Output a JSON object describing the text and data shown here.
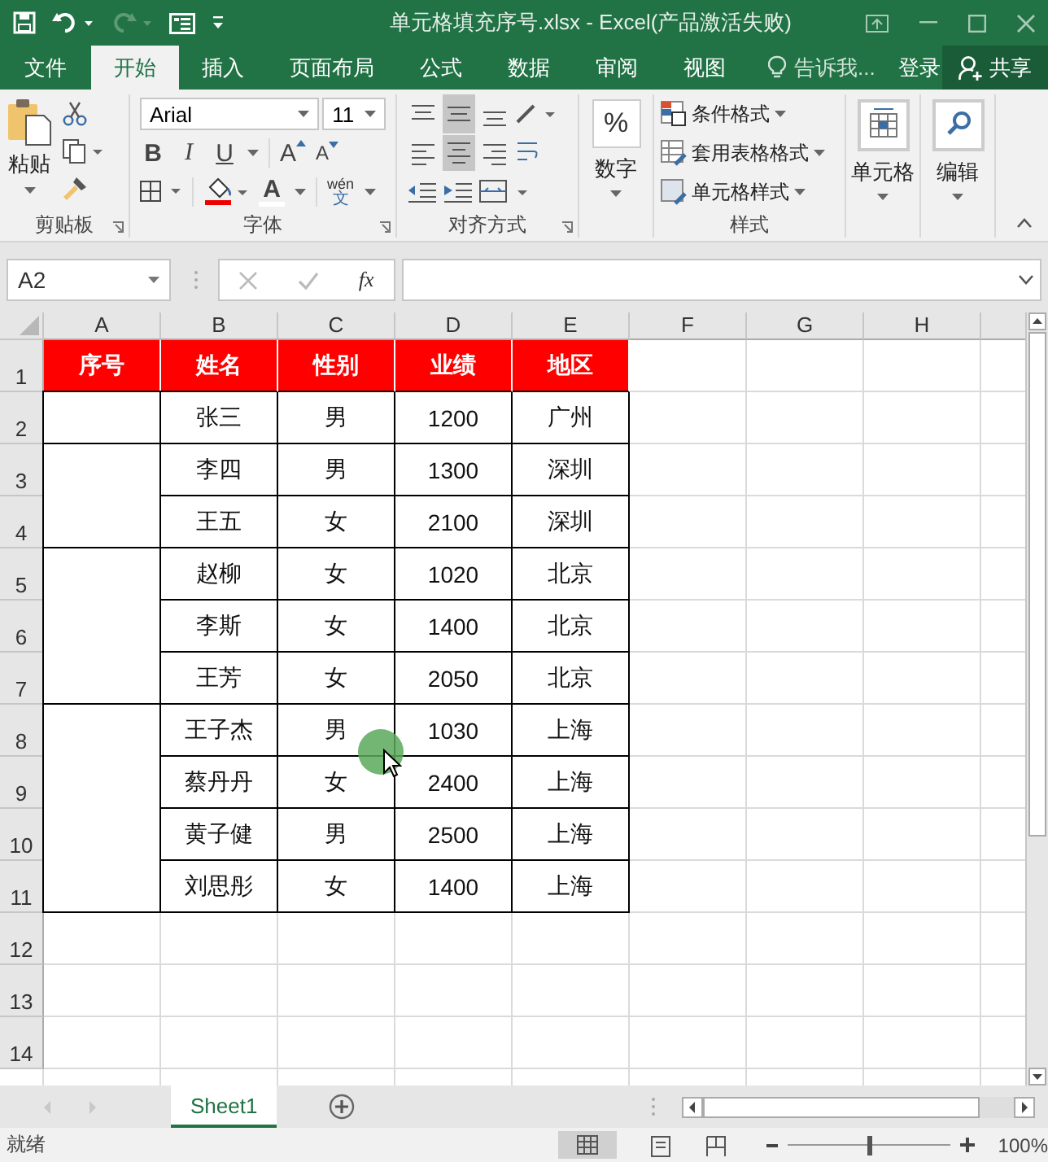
{
  "window": {
    "title": "单元格填充序号.xlsx - Excel(产品激活失败)"
  },
  "menu_tabs": [
    {
      "label": "文件",
      "selected": false
    },
    {
      "label": "开始",
      "selected": true
    },
    {
      "label": "插入",
      "selected": false
    },
    {
      "label": "页面布局",
      "selected": false
    },
    {
      "label": "公式",
      "selected": false
    },
    {
      "label": "数据",
      "selected": false
    },
    {
      "label": "审阅",
      "selected": false
    },
    {
      "label": "视图",
      "selected": false
    }
  ],
  "tell_me": "告诉我...",
  "sign_in": "登录",
  "share": "共享",
  "ribbon": {
    "clipboard": {
      "paste": "粘贴",
      "label": "剪贴板"
    },
    "font": {
      "name": "Arial",
      "size": "11",
      "bold": "B",
      "italic": "I",
      "underline": "U",
      "grow": "A",
      "shrink": "A",
      "font_color_glyph": "A",
      "phonetic_top": "wén",
      "phonetic_bottom": "文",
      "label": "字体"
    },
    "alignment": {
      "label": "对齐方式"
    },
    "number": {
      "symbol": "%",
      "label": "数字"
    },
    "styles": {
      "items": [
        "条件格式",
        "套用表格格式",
        "单元格样式"
      ],
      "label": "样式"
    },
    "cells": {
      "label": "单元格"
    },
    "editing": {
      "label": "编辑"
    }
  },
  "name_box": "A2",
  "fx": "fx",
  "columns": [
    "A",
    "B",
    "C",
    "D",
    "E",
    "F",
    "G",
    "H"
  ],
  "row_numbers": [
    "1",
    "2",
    "3",
    "4",
    "5",
    "6",
    "7",
    "8",
    "9",
    "10",
    "11",
    "12",
    "13",
    "14"
  ],
  "table": {
    "header": [
      "序号",
      "姓名",
      "性别",
      "业绩",
      "地区"
    ],
    "rows": [
      {
        "merged_with_above": false,
        "name": "张三",
        "gender": "男",
        "score": "1200",
        "region": "广州"
      },
      {
        "merged_with_above": false,
        "name": "李四",
        "gender": "男",
        "score": "1300",
        "region": "深圳"
      },
      {
        "merged_with_above": true,
        "name": "王五",
        "gender": "女",
        "score": "2100",
        "region": "深圳"
      },
      {
        "merged_with_above": false,
        "name": "赵柳",
        "gender": "女",
        "score": "1020",
        "region": "北京"
      },
      {
        "merged_with_above": true,
        "name": "李斯",
        "gender": "女",
        "score": "1400",
        "region": "北京"
      },
      {
        "merged_with_above": true,
        "name": "王芳",
        "gender": "女",
        "score": "2050",
        "region": "北京"
      },
      {
        "merged_with_above": false,
        "name": "王子杰",
        "gender": "男",
        "score": "1030",
        "region": "上海"
      },
      {
        "merged_with_above": true,
        "name": "蔡丹丹",
        "gender": "女",
        "score": "2400",
        "region": "上海"
      },
      {
        "merged_with_above": true,
        "name": "黄子健",
        "gender": "男",
        "score": "2500",
        "region": "上海"
      },
      {
        "merged_with_above": true,
        "name": "刘思彤",
        "gender": "女",
        "score": "1400",
        "region": "上海"
      }
    ]
  },
  "sheet_tabs": [
    {
      "label": "Sheet1",
      "selected": true
    }
  ],
  "status": "就绪",
  "zoom": {
    "level": 0.5,
    "reading": "100%"
  }
}
